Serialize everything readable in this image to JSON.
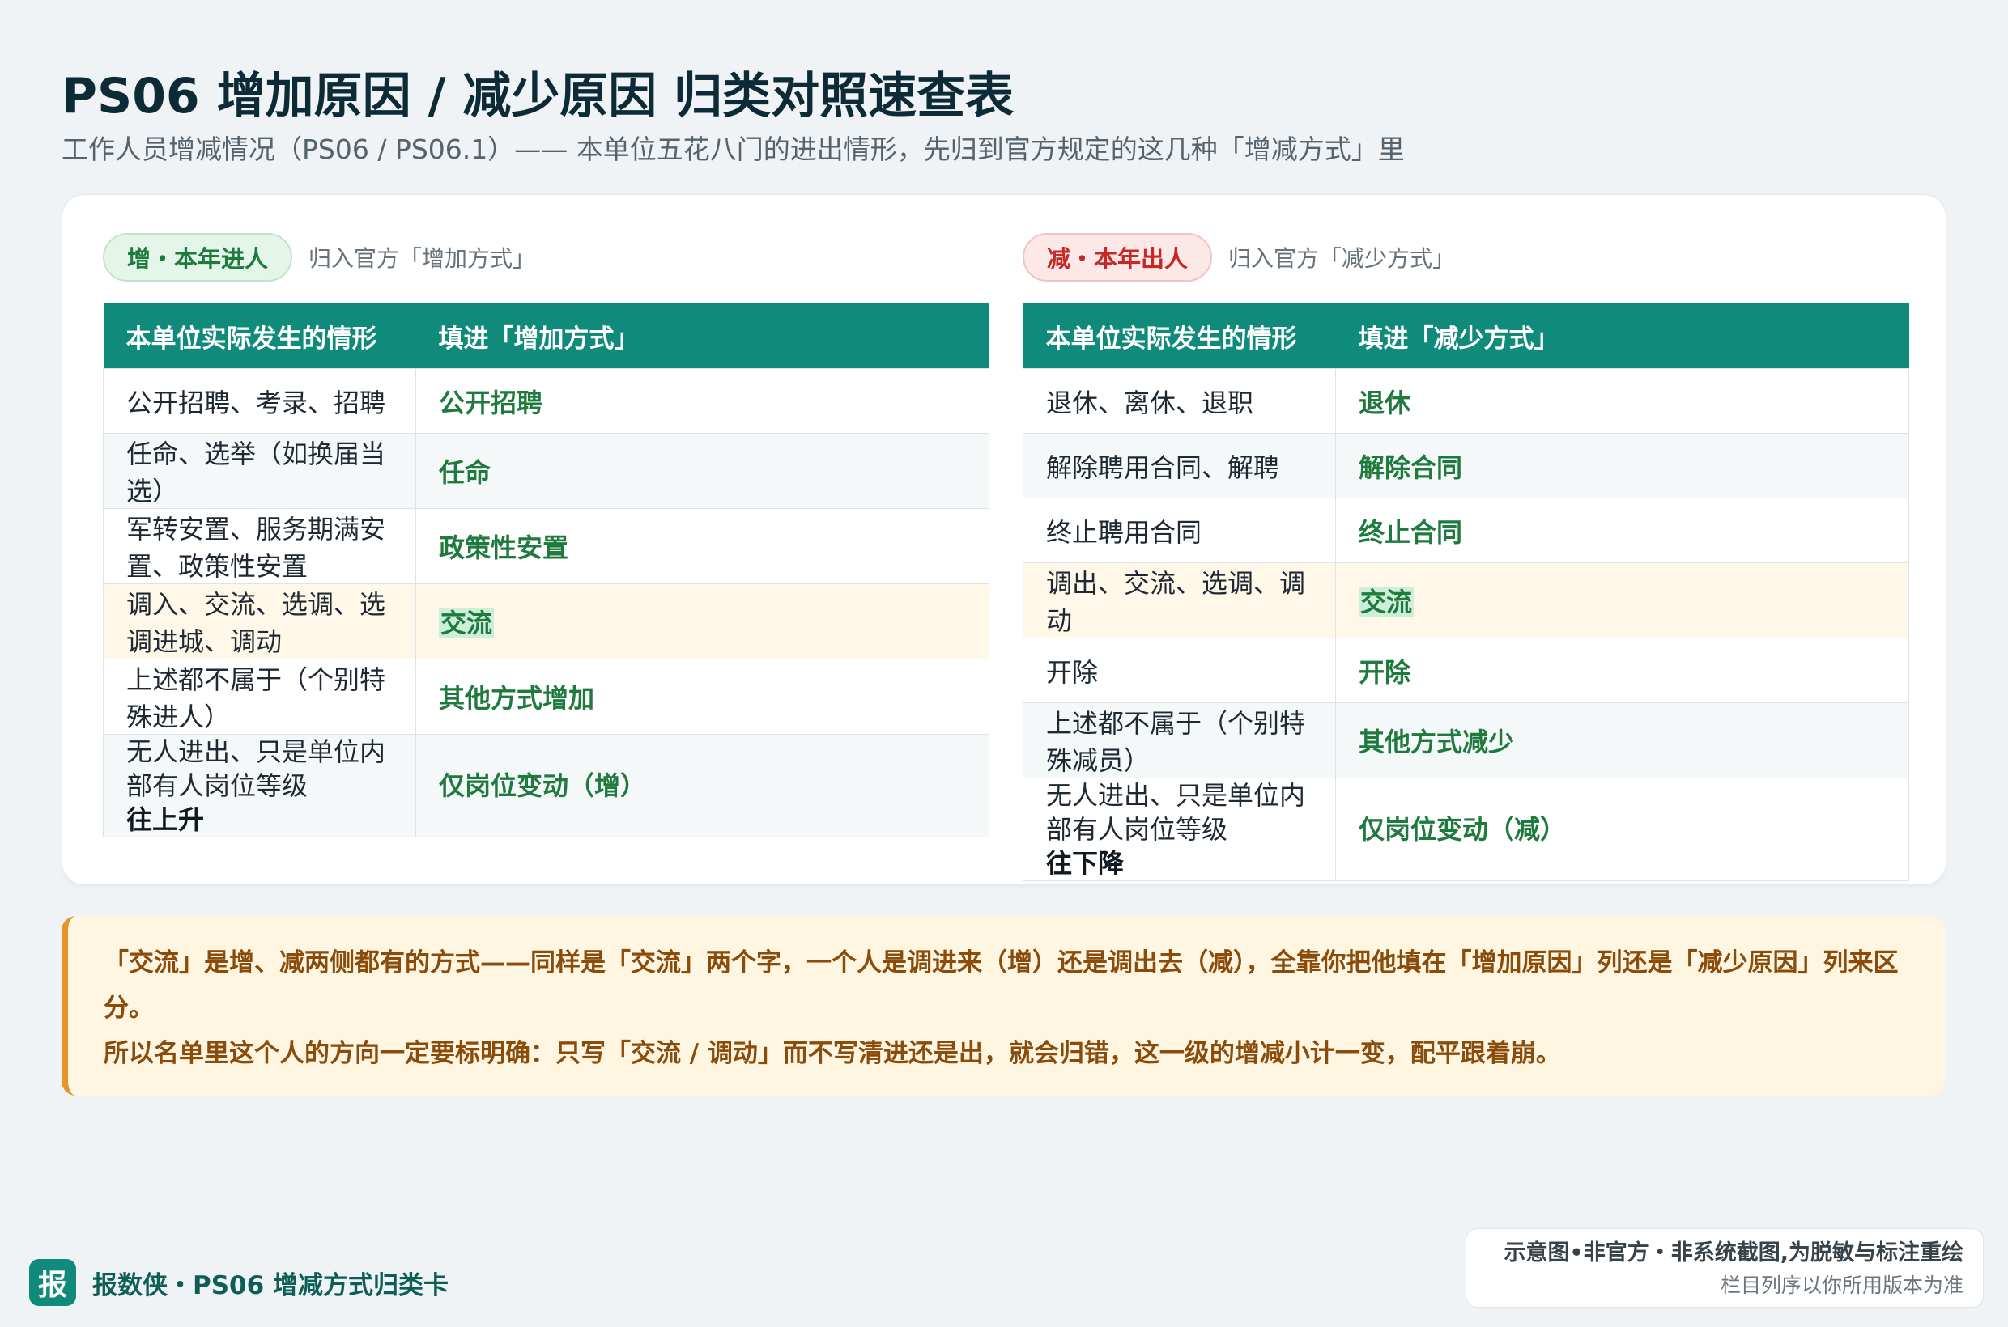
{
  "title": "PS06 增加原因 / 减少原因 归类对照速查表",
  "subtitle": "工作人员增减情况（PS06 / PS06.1）—— 本单位五花八门的进出情形，先归到官方规定的这几种「增减方式」里",
  "increase": {
    "badge": "增・本年进人",
    "note": "归入官方「增加方式」",
    "col_situation": "本单位实际发生的情形",
    "col_way": "填进「增加方式」",
    "rows": [
      {
        "situation": "公开招聘、考录、招聘",
        "way": "公开招聘"
      },
      {
        "situation": "任命、选举（如换届当选）",
        "way": "任命"
      },
      {
        "situation": "军转安置、服务期满安置、政策性安置",
        "way": "政策性安置"
      },
      {
        "situation": "调入、交流、选调、选调进城、调动",
        "way": "交流"
      },
      {
        "situation": "上述都不属于（个别特殊进人）",
        "way": "其他方式增加"
      },
      {
        "situation": "无人进出、只是单位内部有人岗位等级",
        "situation_bold": "往上升",
        "way": "仅岗位变动（增）"
      }
    ]
  },
  "decrease": {
    "badge": "减・本年出人",
    "note": "归入官方「减少方式」",
    "col_situation": "本单位实际发生的情形",
    "col_way": "填进「减少方式」",
    "rows": [
      {
        "situation": "退休、离休、退职",
        "way": "退休"
      },
      {
        "situation": "解除聘用合同、解聘",
        "way": "解除合同"
      },
      {
        "situation": "终止聘用合同",
        "way": "终止合同"
      },
      {
        "situation": "调出、交流、选调、调动",
        "way": "交流"
      },
      {
        "situation": "开除",
        "way": "开除"
      },
      {
        "situation": "上述都不属于（个别特殊减员）",
        "way": "其他方式减少"
      },
      {
        "situation": "无人进出、只是单位内部有人岗位等级",
        "situation_bold": "往下降",
        "way": "仅岗位变动（减）"
      }
    ]
  },
  "note": {
    "line1": "「交流」是增、减两侧都有的方式——同样是「交流」两个字，一个人是调进来（增）还是调出去（减），全靠你把他填在「增加原因」列还是「减少原因」列来区分。",
    "line2": "所以名单里这个人的方向一定要标明确：只写「交流 / 调动」而不写清进还是出，就会归错，这一级的增减小计一变，配平跟着崩。"
  },
  "brand": {
    "logo": "报",
    "text": "报数侠・PS06 增减方式归类卡"
  },
  "disclaimer": {
    "line1": "示意图•非官方・非系统截图,为脱敏与标注重绘",
    "line2": "栏目列序以你所用版本为准"
  },
  "colors": {
    "header": "#108a7a",
    "accent_green": "#1f7a3d",
    "accent_red": "#c62828",
    "note_border": "#e8942c"
  }
}
